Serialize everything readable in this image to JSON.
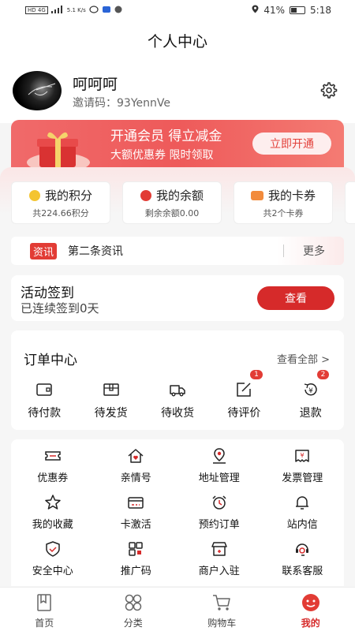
{
  "status_bar": {
    "network": "HD 4G",
    "speed": "5.1 K/s",
    "battery": "41%",
    "time": "5:18"
  },
  "header": {
    "title": "个人中心"
  },
  "profile": {
    "nickname": "呵呵呵",
    "invite": "邀请码：93YennVe"
  },
  "vip": {
    "title": "开通会员 得立减金",
    "subtitle": "大额优惠券 限时领取",
    "button": "立即开通"
  },
  "assets": [
    {
      "title": "我的积分",
      "sub": "共224.66积分",
      "color": "#f4c430"
    },
    {
      "title": "我的余额",
      "sub": "剩余余额0.00",
      "color": "#e23c35"
    },
    {
      "title": "我的卡券",
      "sub": "共2个卡券",
      "color": "#f28b3c"
    }
  ],
  "news": {
    "tag": "资讯",
    "text": "第二条资讯",
    "more": "更多"
  },
  "checkin": {
    "title": "活动签到",
    "sub": "已连续签到0天",
    "button": "查看"
  },
  "orders": {
    "title": "订单中心",
    "more": "查看全部 >",
    "items": [
      {
        "label": "待付款",
        "icon": "wallet-icon",
        "badge": ""
      },
      {
        "label": "待发货",
        "icon": "package-icon",
        "badge": ""
      },
      {
        "label": "待收货",
        "icon": "truck-icon",
        "badge": ""
      },
      {
        "label": "待评价",
        "icon": "edit-icon",
        "badge": "1"
      },
      {
        "label": "退款",
        "icon": "refund-icon",
        "badge": "2"
      }
    ]
  },
  "tools": [
    {
      "label": "优惠券",
      "icon": "coupon-icon"
    },
    {
      "label": "亲情号",
      "icon": "family-icon"
    },
    {
      "label": "地址管理",
      "icon": "location-icon"
    },
    {
      "label": "发票管理",
      "icon": "invoice-icon"
    },
    {
      "label": "我的收藏",
      "icon": "star-icon"
    },
    {
      "label": "卡激活",
      "icon": "card-icon"
    },
    {
      "label": "预约订单",
      "icon": "alarm-icon"
    },
    {
      "label": "站内信",
      "icon": "bell-icon"
    },
    {
      "label": "安全中心",
      "icon": "shield-icon"
    },
    {
      "label": "推广码",
      "icon": "qrcode-icon"
    },
    {
      "label": "商户入驻",
      "icon": "shop-icon"
    },
    {
      "label": "联系客服",
      "icon": "service-icon"
    }
  ],
  "tabbar": [
    {
      "label": "首页",
      "icon": "home-icon",
      "active": false
    },
    {
      "label": "分类",
      "icon": "category-icon",
      "active": false
    },
    {
      "label": "购物车",
      "icon": "cart-icon",
      "active": false
    },
    {
      "label": "我的",
      "icon": "profile-icon",
      "active": true
    }
  ],
  "colors": {
    "accent": "#d62a2a",
    "banner": "#ee5a5a"
  }
}
